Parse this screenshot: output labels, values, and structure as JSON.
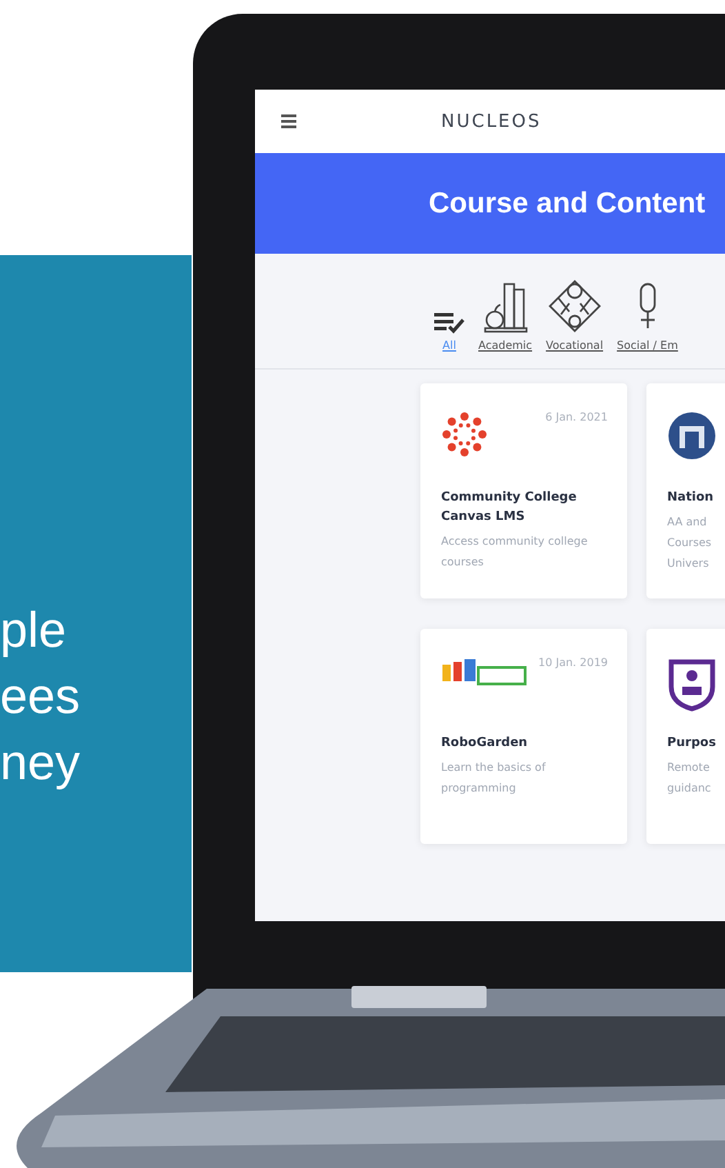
{
  "panel": {
    "lines": [
      "ple",
      "ees",
      "ney"
    ]
  },
  "app": {
    "logo": "NUCLEOS",
    "banner": "Course and Content",
    "categories": [
      {
        "label": "All",
        "kind": "all",
        "selected": true
      },
      {
        "label": "Academic",
        "kind": "academic",
        "selected": false
      },
      {
        "label": "Vocational",
        "kind": "vocational",
        "selected": false
      },
      {
        "label": "Social / Em",
        "kind": "social",
        "selected": false
      }
    ],
    "cards": [
      {
        "kind": "canvas",
        "date": "6 Jan. 2021",
        "title": "Community College Canvas LMS",
        "description": "Access community college courses"
      },
      {
        "kind": "seal",
        "title": "Nation",
        "description": "AA and\nCourses\nUnivers"
      },
      {
        "kind": "robogarden",
        "date": "10 Jan. 2019",
        "title": "RoboGarden",
        "description": "Learn the basics of programming"
      },
      {
        "kind": "shield",
        "title": "Purpos",
        "description": "Remote\nguidanc"
      }
    ]
  }
}
